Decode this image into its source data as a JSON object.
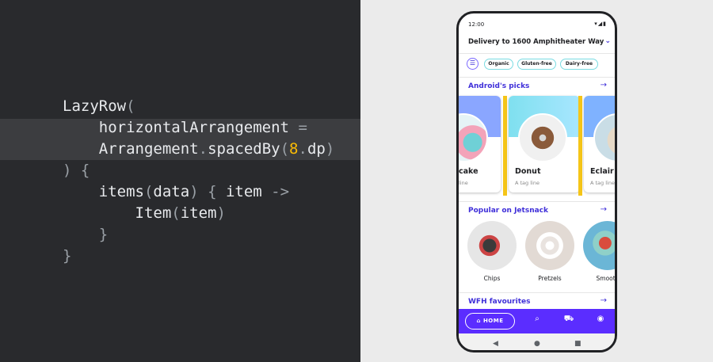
{
  "code": {
    "lines": [
      {
        "indent": "",
        "parts": [
          "LazyRow",
          "("
        ]
      },
      {
        "indent": "    ",
        "parts": [
          "horizontalArrangement ",
          "="
        ]
      },
      {
        "indent": "    ",
        "parts": [
          "Arrangement",
          ".",
          "spacedBy",
          "(",
          "8",
          ".",
          "dp",
          ")"
        ]
      },
      {
        "indent": "",
        "parts": [
          ") {"
        ]
      },
      {
        "indent": "    ",
        "parts": [
          "items",
          "(",
          "data",
          ")",
          " { ",
          "item ",
          "->"
        ]
      },
      {
        "indent": "        ",
        "parts": [
          "Item",
          "(",
          "item",
          ")"
        ]
      },
      {
        "indent": "    ",
        "parts": [
          "}"
        ]
      },
      {
        "indent": "",
        "parts": [
          "}"
        ]
      }
    ],
    "highlight_color": "#3c3d40",
    "number_color": "#fbbc04"
  },
  "phone": {
    "status": {
      "time": "12:00",
      "icons": "signal-wifi-battery"
    },
    "delivery": {
      "text": "Delivery to 1600 Amphitheater Way",
      "icon": "chevron-down-icon"
    },
    "filters": {
      "icon": "filter-icon",
      "chips": [
        "Organic",
        "Gluten-free",
        "Dairy-free"
      ]
    },
    "sections": {
      "androids_picks": {
        "title": "Android's picks",
        "arrow": "arrow-right-icon"
      },
      "popular": {
        "title": "Popular on Jetsnack",
        "arrow": "arrow-right-icon"
      },
      "wfh": {
        "title": "WFH favourites",
        "arrow": "arrow-right-icon"
      }
    },
    "picks": [
      {
        "name": "cake",
        "tag": "line"
      },
      {
        "name": "Donut",
        "tag": "A tag line"
      },
      {
        "name": "Eclair",
        "tag": "A tag line"
      }
    ],
    "popular_items": [
      "Chips",
      "Pretzels",
      "Smooth"
    ],
    "bottom_nav": {
      "home_label": "HOME",
      "icons": [
        "home-icon",
        "search-icon",
        "cart-icon",
        "profile-icon"
      ]
    },
    "system_nav": [
      "back-icon",
      "home-circle-icon",
      "recents-icon"
    ],
    "accent_color": "#5b2dff",
    "spacer_color": "#f5c518"
  }
}
